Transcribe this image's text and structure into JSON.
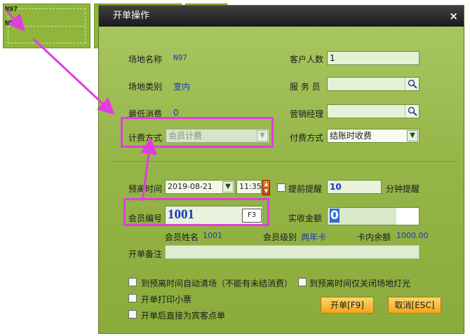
{
  "thumbs": {
    "label1": "N97",
    "label2": "N97"
  },
  "dialog": {
    "title": "开单操作",
    "close": "×",
    "venue_name_label": "场地名称",
    "venue_name_value": "N97",
    "venue_type_label": "场地类别",
    "venue_type_value": "室内",
    "min_spend_label": "最低消费",
    "min_spend_value": "0",
    "billing_label": "计费方式",
    "billing_value": "会员计费",
    "customers_label": "客户人数",
    "customers_value": "1",
    "waiter_label": "服 务 员",
    "waiter_value": "",
    "sales_mgr_label": "营销经理",
    "sales_mgr_value": "",
    "payment_label": "付费方式",
    "payment_value": "结账时收费",
    "leave_time_label": "预离时间",
    "leave_date": "2019-08-21",
    "leave_clock": "11:35",
    "remind_label": "提前提醒",
    "remind_value": "10",
    "remind_unit": "分钟提醒",
    "member_no_label": "会员编号",
    "member_no_value": "1001",
    "f3_label": "F3",
    "received_label": "实收金额",
    "received_value": "0",
    "member_name_label": "会员姓名",
    "member_name_value": "1001",
    "member_level_label": "会员级别",
    "member_level_value": "两年卡",
    "card_balance_label": "卡内余额",
    "card_balance_value": "1000.00",
    "remark_label": "开单备注",
    "remark_value": "",
    "cb_auto_clear": "到预离时间自动清场（不能有未结消费）",
    "cb_lights_off": "到预离时间仅关闭场地灯光",
    "cb_print": "开单打印小票",
    "cb_guest": "开单后直接为宾客点单",
    "ok_button": "开单[F9]",
    "cancel_button": "取消[ESC]"
  },
  "colors": {
    "accent": "#e23ce0",
    "dialog_bg": "#95b548",
    "value_text": "#1a36c0"
  },
  "icons": [
    "search-icon",
    "dropdown-icon",
    "spin-icon",
    "close-icon"
  ]
}
